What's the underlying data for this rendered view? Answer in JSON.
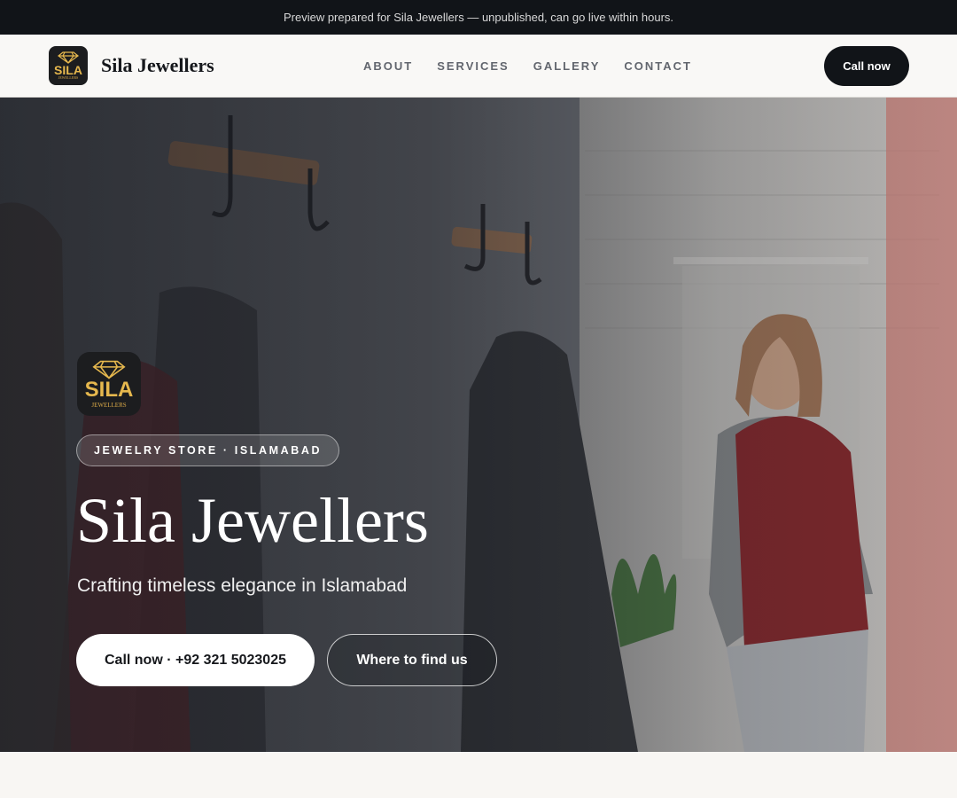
{
  "preview_banner": "Preview prepared for Sila Jewellers — unpublished, can go live within hours.",
  "brand": {
    "name": "Sila Jewellers",
    "logo_word": "SILA",
    "logo_sub": "JEWELLERS",
    "gold": "#e6b84e"
  },
  "nav": {
    "links": [
      "ABOUT",
      "SERVICES",
      "GALLERY",
      "CONTACT"
    ],
    "cta": "Call now"
  },
  "hero": {
    "badge": "JEWELRY STORE · ISLAMABAD",
    "title": "Sila Jewellers",
    "subtitle": "Crafting timeless elegance in Islamabad",
    "primary_cta": "Call now · +92 321 5023025",
    "secondary_cta": "Where to find us"
  }
}
